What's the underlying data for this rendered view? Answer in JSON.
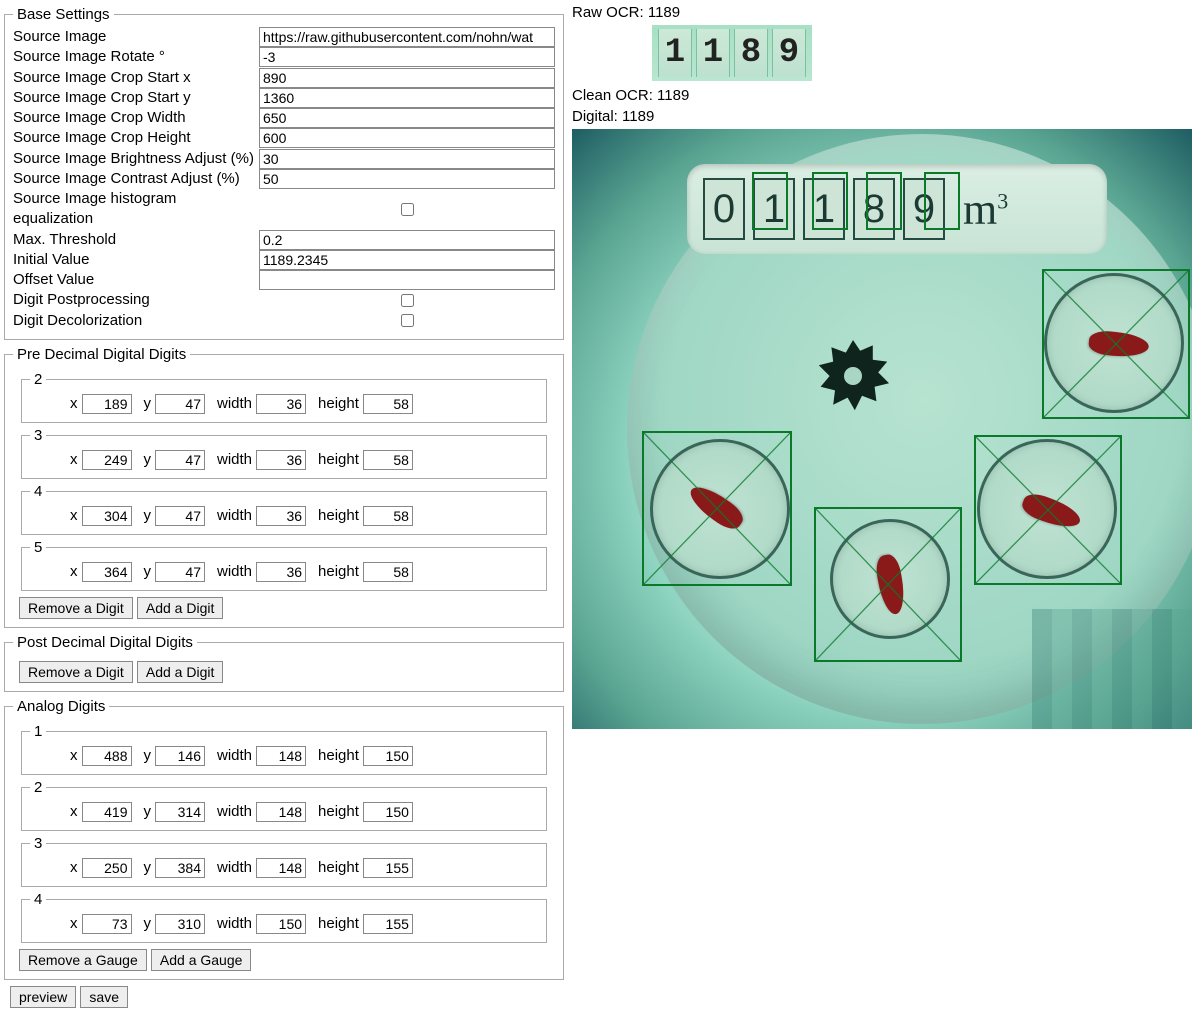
{
  "ocr": {
    "raw_label": "Raw OCR:",
    "raw_value": "1189",
    "clean_label": "Clean OCR:",
    "clean_value": "1189",
    "digital_label": "Digital:",
    "digital_value": "1189",
    "preview_chars": [
      "1",
      "1",
      "8",
      "9"
    ]
  },
  "base": {
    "legend": "Base Settings",
    "rows": [
      {
        "label": "Source Image",
        "value": "https://raw.githubusercontent.com/nohn/wat"
      },
      {
        "label": "Source Image Rotate °",
        "value": "-3"
      },
      {
        "label": "Source Image Crop Start x",
        "value": "890"
      },
      {
        "label": "Source Image Crop Start y",
        "value": "1360"
      },
      {
        "label": "Source Image Crop Width",
        "value": "650"
      },
      {
        "label": "Source Image Crop Height",
        "value": "600"
      },
      {
        "label": "Source Image Brightness Adjust (%)",
        "value": "30"
      },
      {
        "label": "Source Image Contrast Adjust (%)",
        "value": "50"
      }
    ],
    "hist_label": "Source Image histogram equalization",
    "rows2": [
      {
        "label": "Max. Threshold",
        "value": "0.2"
      },
      {
        "label": "Initial Value",
        "value": "1189.2345"
      },
      {
        "label": "Offset Value",
        "value": ""
      }
    ],
    "post_label": "Digit Postprocessing",
    "decol_label": "Digit Decolorization"
  },
  "pre": {
    "legend": "Pre Decimal Digital Digits",
    "digits": [
      {
        "num": "2",
        "x": "189",
        "y": "47",
        "w": "36",
        "h": "58"
      },
      {
        "num": "3",
        "x": "249",
        "y": "47",
        "w": "36",
        "h": "58"
      },
      {
        "num": "4",
        "x": "304",
        "y": "47",
        "w": "36",
        "h": "58"
      },
      {
        "num": "5",
        "x": "364",
        "y": "47",
        "w": "36",
        "h": "58"
      }
    ],
    "remove": "Remove a Digit",
    "add": "Add a Digit"
  },
  "post": {
    "legend": "Post Decimal Digital Digits",
    "remove": "Remove a Digit",
    "add": "Add a Digit"
  },
  "analog": {
    "legend": "Analog Digits",
    "digits": [
      {
        "num": "1",
        "x": "488",
        "y": "146",
        "w": "148",
        "h": "150"
      },
      {
        "num": "2",
        "x": "419",
        "y": "314",
        "w": "148",
        "h": "150"
      },
      {
        "num": "3",
        "x": "250",
        "y": "384",
        "w": "148",
        "h": "155"
      },
      {
        "num": "4",
        "x": "73",
        "y": "310",
        "w": "150",
        "h": "155"
      }
    ],
    "remove": "Remove a Gauge",
    "add": "Add a Gauge"
  },
  "field_labels": {
    "x": "x",
    "y": "y",
    "w": "width",
    "h": "height"
  },
  "buttons": {
    "preview": "preview",
    "save": "save"
  },
  "odo_wheels": [
    "0",
    "1",
    "1",
    "8",
    "9"
  ],
  "odo_unit": "m"
}
